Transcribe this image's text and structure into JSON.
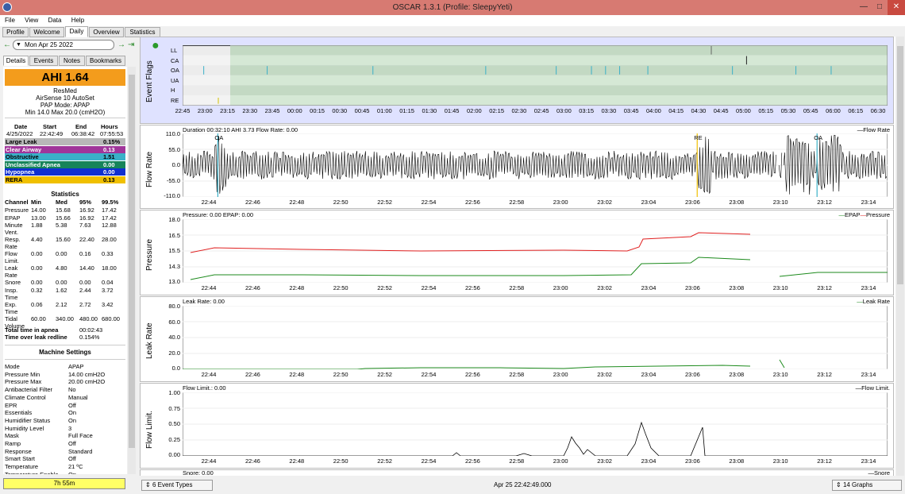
{
  "window": {
    "title": "OSCAR 1.3.1 (Profile: SleepyYeti)"
  },
  "menu": [
    "File",
    "View",
    "Data",
    "Help"
  ],
  "top_tabs": [
    "Profile",
    "Welcome",
    "Daily",
    "Overview",
    "Statistics"
  ],
  "date_nav": {
    "date": "Mon Apr 25 2022"
  },
  "sub_tabs": [
    "Details",
    "Events",
    "Notes",
    "Bookmarks"
  ],
  "summary": {
    "ahi": "AHI 1.64",
    "brand": "ResMed",
    "model": "AirSense 10 AutoSet",
    "mode": "PAP Mode: APAP",
    "pressure_range": "Min 14.0 Max 20.0 (cmH2O)",
    "session_headers": [
      "Date",
      "Start",
      "End",
      "Hours"
    ],
    "session_values": [
      "4/25/2022",
      "22:42:49",
      "06:38:42",
      "07:55:53"
    ]
  },
  "event_rows": [
    {
      "label": "Large Leak",
      "value": "0.15%",
      "color": "#b8b8b8",
      "text": "#000"
    },
    {
      "label": "Clear Airway",
      "value": "0.13",
      "color": "#a0359a",
      "text": "#fff"
    },
    {
      "label": "Obstructive",
      "value": "1.51",
      "color": "#3ab0c8",
      "text": "#000"
    },
    {
      "label": "Unclassified Apnea",
      "value": "0.00",
      "color": "#16845a",
      "text": "#fff"
    },
    {
      "label": "Hypopnea",
      "value": "0.00",
      "color": "#1030d0",
      "text": "#fff"
    },
    {
      "label": "RERA",
      "value": "0.13",
      "color": "#f0c000",
      "text": "#000"
    }
  ],
  "statistics": {
    "title": "Statistics",
    "headers": [
      "Channel",
      "Min",
      "Med",
      "95%",
      "99.5%"
    ],
    "rows": [
      [
        "Pressure",
        "14.00",
        "15.68",
        "16.92",
        "17.42"
      ],
      [
        "EPAP",
        "13.00",
        "15.66",
        "16.92",
        "17.42"
      ],
      [
        "Minute Vent.",
        "1.88",
        "5.38",
        "7.63",
        "12.88"
      ],
      [
        "Resp. Rate",
        "4.40",
        "15.60",
        "22.40",
        "28.00"
      ],
      [
        "Flow Limit.",
        "0.00",
        "0.00",
        "0.16",
        "0.33"
      ],
      [
        "Leak Rate",
        "0.00",
        "4.80",
        "14.40",
        "18.00"
      ],
      [
        "Snore",
        "0.00",
        "0.00",
        "0.00",
        "0.04"
      ],
      [
        "Insp. Time",
        "0.32",
        "1.62",
        "2.44",
        "3.72"
      ],
      [
        "Exp. Time",
        "0.06",
        "2.12",
        "2.72",
        "3.42"
      ],
      [
        "Tidal Volume",
        "60.00",
        "340.00",
        "480.00",
        "680.00"
      ]
    ],
    "apnea_label": "Total time in apnea",
    "apnea_value": "00:02:43",
    "leak_label": "Time over leak redline",
    "leak_value": "0.154%"
  },
  "machine_settings": {
    "title": "Machine Settings",
    "rows": [
      [
        "Mode",
        "APAP"
      ],
      [
        "Pressure Min",
        "14.00 cmH2O"
      ],
      [
        "Pressure Max",
        "20.00 cmH2O"
      ],
      [
        "Antibacterial Filter",
        "No"
      ],
      [
        "Climate Control",
        "Manual"
      ],
      [
        "EPR",
        "Off"
      ],
      [
        "Essentials",
        "On"
      ],
      [
        "Humidifier Status",
        "On"
      ],
      [
        "Humidity Level",
        "3"
      ],
      [
        "Mask",
        "Full Face"
      ],
      [
        "Ramp",
        "Off"
      ],
      [
        "Response",
        "Standard"
      ],
      [
        "Smart Start",
        "Off"
      ],
      [
        "Temperature",
        "21 ºC"
      ],
      [
        "Temperature Enable",
        "On"
      ]
    ]
  },
  "total_time": "7h 55m",
  "event_flags": {
    "ylabel": "Event Flags",
    "rows": [
      "LL",
      "CA",
      "OA",
      "UA",
      "H",
      "RE"
    ],
    "x_ticks": [
      "22:45",
      "23:00",
      "23:15",
      "23:30",
      "23:45",
      "00:00",
      "00:15",
      "00:30",
      "00:45",
      "01:00",
      "01:15",
      "01:30",
      "01:45",
      "02:00",
      "02:15",
      "02:30",
      "02:45",
      "03:00",
      "03:15",
      "03:30",
      "03:45",
      "04:00",
      "04:15",
      "04:30",
      "04:45",
      "05:00",
      "05:15",
      "05:30",
      "05:45",
      "06:00",
      "06:15",
      "06:30"
    ],
    "oa_marks": [
      0.03,
      0.12,
      0.27,
      0.43,
      0.53,
      0.58,
      0.6,
      0.62,
      0.66,
      0.78,
      0.87,
      0.92
    ],
    "ca_marks": [
      0.8
    ],
    "ll_marks": [
      0.75
    ]
  },
  "x_ticks_zoom": [
    "22:44",
    "22:46",
    "22:48",
    "22:50",
    "22:52",
    "22:54",
    "22:56",
    "22:58",
    "23:00",
    "23:02",
    "23:04",
    "23:06",
    "23:08",
    "23:10",
    "23:12",
    "23:14"
  ],
  "flow": {
    "ylabel": "Flow Rate",
    "header": "Duration 00:32:10 AHI 3.73 Flow Rate: 0.00",
    "legend": "Flow Rate",
    "yticks": [
      "110.0",
      "55.0",
      "0.0",
      "-55.0",
      "-110.0"
    ],
    "events": [
      {
        "label": "OA",
        "x": 0.05
      },
      {
        "label": "RE",
        "x": 0.73
      },
      {
        "label": "OA",
        "x": 0.9
      }
    ]
  },
  "pressure": {
    "ylabel": "Pressure",
    "header": "Pressure: 0.00 EPAP: 0.00",
    "legend_a": "EPAP",
    "legend_b": "Pressure",
    "yticks": [
      "18.0",
      "16.5",
      "15.5",
      "14.3",
      "13.0"
    ],
    "color_pressure": "#e02020",
    "color_epap": "#1c8a1c"
  },
  "leak": {
    "ylabel": "Leak Rate",
    "header": "Leak Rate: 0.00",
    "legend": "Leak Rate",
    "yticks": [
      "80.0",
      "60.0",
      "40.0",
      "20.0",
      "0.0"
    ],
    "color": "#1c8a1c"
  },
  "flowlimit": {
    "ylabel": "Flow Limit.",
    "header": "Flow Limit.: 0.00",
    "legend": "Flow Limit.",
    "yticks": [
      "1.00",
      "0.75",
      "0.50",
      "0.25",
      "0.00"
    ]
  },
  "snore": {
    "header": "Snore: 0.00",
    "legend": "Snore"
  },
  "status": {
    "event_types": "6 Event Types",
    "timestamp": "Apr 25 22:42:49.000",
    "graphs": "14 Graphs"
  }
}
